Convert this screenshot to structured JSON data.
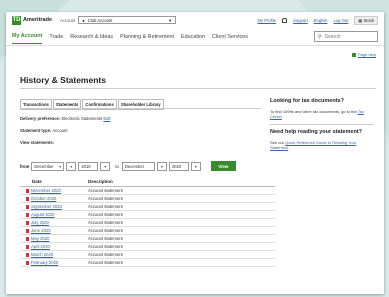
{
  "brand": {
    "logo_letters": "TD",
    "name": "Ameritrade"
  },
  "header": {
    "account_label": "Account",
    "account_value": "Club Account",
    "links": [
      "My Profile",
      "Support",
      "English",
      "Log Out"
    ],
    "stock_button": "Stock"
  },
  "nav": {
    "items": [
      "My Account",
      "Trade",
      "Research & Ideas",
      "Planning & Retirement",
      "Education",
      "Client Services"
    ],
    "search_placeholder": "Search"
  },
  "help_link": "Page help",
  "page": {
    "title": "History & Statements",
    "tabs": [
      "Transactions",
      "Statements",
      "Confirmations",
      "Shareholder Library"
    ],
    "delivery_label": "Delivery preference:",
    "delivery_value": "Electronic Statements",
    "delivery_edit": "Edit",
    "statement_type_label": "Statement type:",
    "statement_type_value": "Account",
    "view_statements_label": "View statements:",
    "from_label": "from",
    "to_label": "to",
    "from_month": "December",
    "from_year": "2019",
    "to_month": "December",
    "to_year": "2020",
    "view_button": "View"
  },
  "table": {
    "headers": [
      "Date",
      "Description"
    ],
    "rows": [
      {
        "date": "November 2020",
        "desc": "Account statement"
      },
      {
        "date": "October 2020",
        "desc": "Account statement"
      },
      {
        "date": "September 2020",
        "desc": "Account statement"
      },
      {
        "date": "August 2020",
        "desc": "Account statement"
      },
      {
        "date": "July 2020",
        "desc": "Account statement"
      },
      {
        "date": "June 2020",
        "desc": "Account statement"
      },
      {
        "date": "May 2020",
        "desc": "Account statement"
      },
      {
        "date": "April 2020",
        "desc": "Account statement"
      },
      {
        "date": "March 2020",
        "desc": "Account statement"
      },
      {
        "date": "February 2020",
        "desc": "Account statement"
      }
    ]
  },
  "sidebar": {
    "tax_title": "Looking for tax documents?",
    "tax_text_a": "To find 1099s and other tax documents,",
    "tax_text_b": "go to the",
    "tax_link": "Tax Center",
    "help_title": "Need help reading your statement?",
    "help_text": "See our",
    "help_link": "Quick Reference Guide to Reading Your Statement"
  },
  "colors": {
    "accent": "#3a8a2c",
    "link": "#3a63a8",
    "pdf": "#c23b2e"
  }
}
